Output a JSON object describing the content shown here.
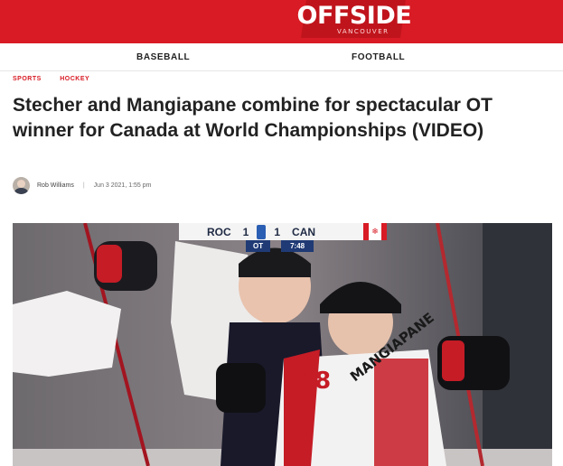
{
  "site": {
    "logo_text": "OFFSIDE",
    "logo_sub": "VANCOUVER",
    "brand_color": "#d81b24"
  },
  "nav": {
    "items": [
      {
        "label": "BASEBALL"
      },
      {
        "label": "FOOTBALL"
      }
    ]
  },
  "article": {
    "categories": [
      "SPORTS",
      "HOCKEY"
    ],
    "title": "Stecher and Mangiapane combine for spectacular OT winner for Canada at World Championships (VIDEO)",
    "author": "Rob Williams",
    "separator": "|",
    "date": "Jun 3 2021, 1:55 pm"
  },
  "video": {
    "scoreboard": {
      "home_team": "ROC",
      "home_score": "1",
      "away_score": "1",
      "away_team": "CAN",
      "period": "OT",
      "clock": "7:48"
    },
    "jersey_number": "88",
    "jersey_name": "MANGIAPANE"
  }
}
